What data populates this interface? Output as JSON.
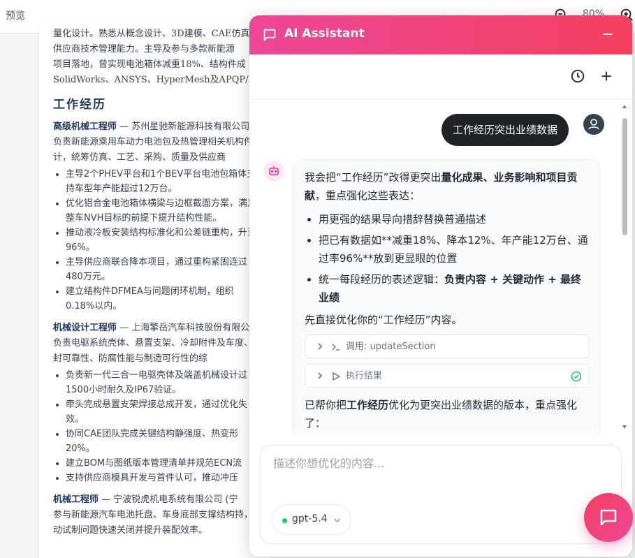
{
  "topbar": {
    "title": "预览",
    "zoom": "80%"
  },
  "document": {
    "intro_lines": [
      "量化设计。熟悉从概念设计、3D建模、CAE仿真",
      "供应商技术管理能力。主导及参与多款新能源",
      "项目落地，曾实现电池箱体减重18%、结构件成",
      "SolidWorks、ANSYS、HyperMesh及APQP/P"
    ],
    "section_title": "工作经历",
    "jobs": [
      {
        "role": "高级机械工程师",
        "company": " — 苏州星驰新能源科技有限公司",
        "desc": "负责新能源乘用车动力电池包及热管理相关机构件设计，统筹仿真、工艺、采购、质量及供应商",
        "bullets": [
          "主导2个PHEV平台和1个BEV平台电池包箱体支持车型年产能超过12万台。",
          "优化铝合金电池箱体横梁与边框截面方案，满足整车NVH目标的前提下提升结构性能。",
          "推动液冷板安装结构标准化和公差链重构，升至96%。",
          "主导供应商联合降本项目，通过重构紧固连过480万元。",
          "建立结构件DFMEA与问题闭环机制，组织0.18%以内。"
        ]
      },
      {
        "role": "机械设计工程师",
        "company": " — 上海擎岳汽车科技股份有限公司",
        "desc": "负责电驱系统壳体、悬置支架、冷却附件及车度、密封可靠性、防腐性能与制造可行性的综",
        "bullets": [
          "负责新一代三合一电驱壳体及端盖机械设计过1500小时耐久及IP67验证。",
          "牵头完成悬置支架焊接总成开发，通过优化失效。",
          "协同CAE团队完成关键结构静强度、热变形20%。",
          "建立BOM与图纸版本管理清单并规范ECN流",
          "支持供应商模具开发与首件认可，推动冲压"
        ]
      },
      {
        "role": "机械工程师",
        "company": " — 宁波锐虎机电系统有限公司 (宁",
        "desc": "参与新能源汽车电池托盘、车身底部支撑结构持，推动试制问题快速关闭并提升装配效率。",
        "bullets": []
      }
    ]
  },
  "assistant": {
    "title": "AI Assistant",
    "user_message": "工作经历突出业绩数据",
    "reply": {
      "p1_pre": "我会把“工作经历”改得更突出",
      "p1_bold": "量化成果、业务影响和项目贡献",
      "p1_post": "，重点强化这些表达：",
      "bullets": [
        {
          "text": "用更强的结果导向措辞替换普通描述",
          "bold": ""
        },
        {
          "text": "把已有数据如**减重18%、降本12%、年产能12万台、通过率96%**放到更显眼的位置",
          "bold": ""
        },
        {
          "text": "统一每段经历的表述逻辑：",
          "bold": "负责内容 + 关键动作 + 最终业绩"
        }
      ],
      "p2": "先直接优化你的“工作经历”内容。",
      "tool_call_label": "调用: updateSection",
      "tool_result_label": "执行结果",
      "p3_pre": "已帮你把",
      "p3_bold": "工作经历",
      "p3_post": "优化为更突出业绩数据的版本，重点强化了："
    },
    "composer": {
      "placeholder": "描述你想优化的内容..."
    },
    "model": "gpt-5.4"
  },
  "colors": {
    "accent": "#ec4899",
    "accent2": "#f43f5e",
    "ok": "#22c55e"
  }
}
